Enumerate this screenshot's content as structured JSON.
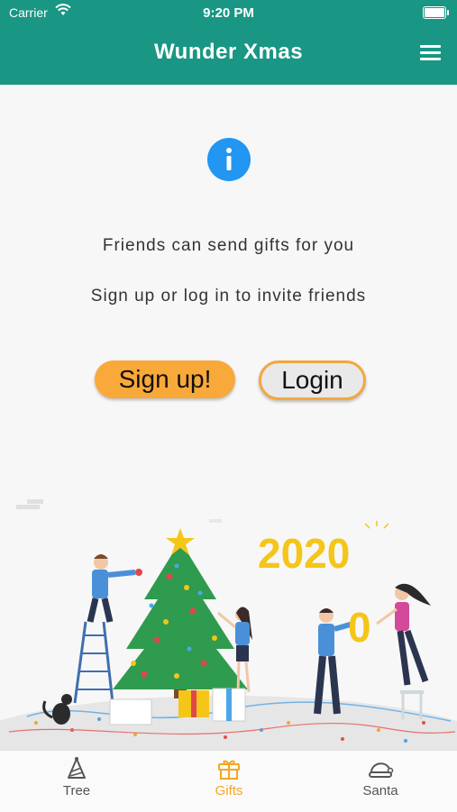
{
  "status_bar": {
    "carrier": "Carrier",
    "time": "9:20 PM"
  },
  "header": {
    "title": "Wunder Xmas",
    "menu_icon": "hamburger-menu-icon"
  },
  "main": {
    "info_icon": "info-icon",
    "message_1": "Friends can send gifts for you",
    "message_2": "Sign up or log in to invite friends",
    "signup_label": "Sign up!",
    "login_label": "Login"
  },
  "illustration": {
    "year_text": "2020",
    "held_digit": "0"
  },
  "tabs": [
    {
      "label": "Tree",
      "icon": "party-hat-icon",
      "active": false
    },
    {
      "label": "Gifts",
      "icon": "gift-icon",
      "active": true
    },
    {
      "label": "Santa",
      "icon": "santa-hat-icon",
      "active": false
    }
  ],
  "colors": {
    "header": "#1a9684",
    "accent": "#f5a623",
    "info": "#2196f3"
  }
}
